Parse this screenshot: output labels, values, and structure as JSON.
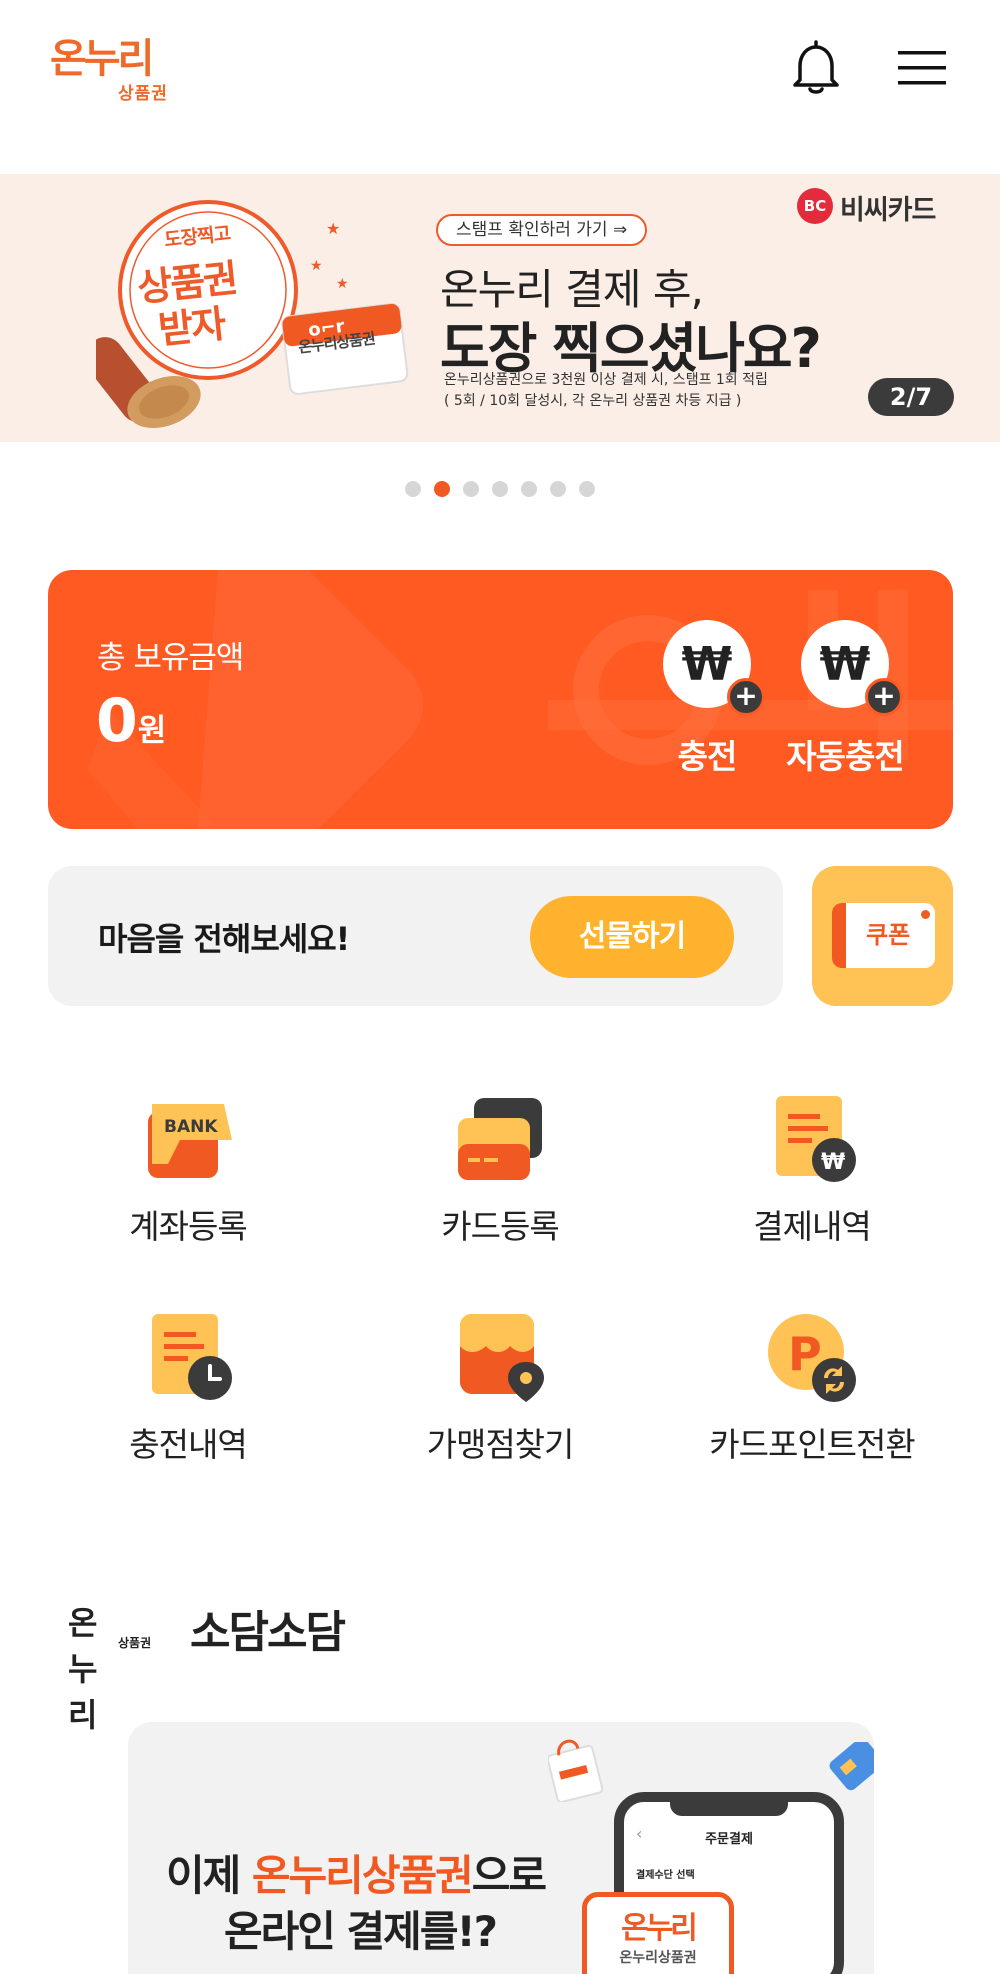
{
  "header": {
    "logo_text": "온누리",
    "logo_sub": "상품권"
  },
  "banner": {
    "stamp_top": "도장찍고",
    "stamp_main1": "상품권",
    "stamp_main2": "받자",
    "stamp_card": "온누리상품권",
    "pill": "스탬프 확인하러 가기 ⇒",
    "line1": "온누리 결제 후,",
    "line2": "도장 찍으셨나요?",
    "small1": "온누리상품권으로 3천원 이상 결제 시, 스탬프 1회 적립",
    "small2": "( 5회 / 10회 달성시, 각 온누리 상품권 차등 지급 )",
    "partner_mark": "BC",
    "partner": "비씨카드",
    "page": "2/7",
    "dot_count": 7,
    "active_dot": 2
  },
  "balance": {
    "label": "총 보유금액",
    "amount": "0",
    "unit": "원",
    "won_symbol": "₩",
    "plus": "+",
    "charge_label": "충전",
    "auto_charge_label": "자동충전"
  },
  "gift": {
    "text": "마음을 전해보세요!",
    "button": "선물하기",
    "coupon": "쿠폰"
  },
  "menu": {
    "items": [
      {
        "label": "계좌등록",
        "icon": "bank-icon",
        "icon_text": "BANK"
      },
      {
        "label": "카드등록",
        "icon": "card-icon"
      },
      {
        "label": "결제내역",
        "icon": "payment-history-icon"
      },
      {
        "label": "충전내역",
        "icon": "charge-history-icon"
      },
      {
        "label": "가맹점찾기",
        "icon": "store-finder-icon"
      },
      {
        "label": "카드포인트전환",
        "icon": "point-convert-icon",
        "icon_text": "P"
      }
    ]
  },
  "sodam": {
    "logo": "온누리",
    "logo_sub": "상품권",
    "title": "소담소담"
  },
  "promo": {
    "line1_pre": "이제 ",
    "line1_highlight": "온누리상품권",
    "line1_post": "으로",
    "line2": "온라인 결제를!?",
    "phone_title": "주문결제",
    "phone_sub": "결제수단 선택",
    "card_logo": "온누리",
    "card_sub": "온누리상품권"
  },
  "colors": {
    "brand_orange": "#ff5a22",
    "accent_yellow": "#ffb22e",
    "dark": "#3b3b3b"
  }
}
